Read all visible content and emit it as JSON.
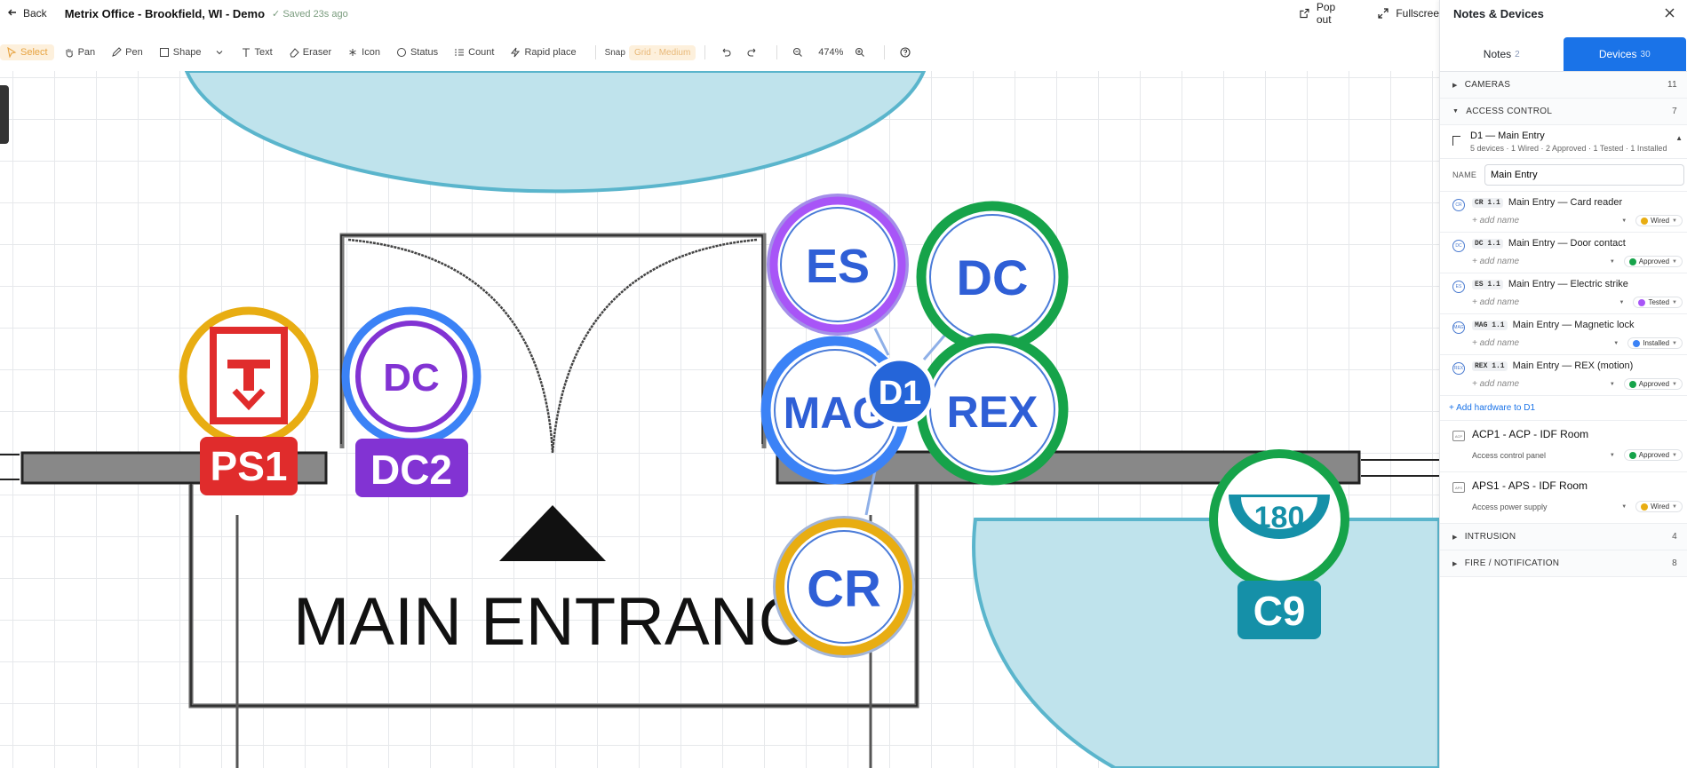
{
  "header": {
    "back_label": "Back",
    "title": "Metrix Office - Brookfield, WI - Demo",
    "saved": "✓ Saved 23s ago",
    "popout": "Pop out",
    "fullscreen": "Fullscree"
  },
  "toolbar": {
    "tools": [
      "Select",
      "Pan",
      "Pen",
      "Shape",
      "Text",
      "Eraser",
      "Icon",
      "Status",
      "Count",
      "Rapid place"
    ],
    "snap": "Snap",
    "grid": "Grid · Medium",
    "zoom": "474%"
  },
  "canvas": {
    "entrance_label": "MAIN ENTRANC",
    "devices": {
      "ps1": "PS1",
      "dc2_icon": "DC",
      "dc2": "DC2",
      "es": "ES",
      "dc": "DC",
      "mag": "MAG",
      "d1": "D1",
      "rex": "REX",
      "cr": "CR",
      "c9_angle": "180",
      "c9": "C9"
    },
    "colors": {
      "red": "#e02c2c",
      "purple": "#8233d3",
      "blue": "#3b82f6",
      "green": "#16a34a",
      "yellow": "#e8ad12",
      "teal": "#1590a8",
      "text_blue": "#2f5fd6",
      "room": "#bfe3ec"
    }
  },
  "panel": {
    "title": "Notes & Devices",
    "tabs": [
      {
        "label": "Notes",
        "count": "2"
      },
      {
        "label": "Devices",
        "count": "30"
      }
    ],
    "categories": {
      "cameras": {
        "label": "CAMERAS",
        "count": "11"
      },
      "access": {
        "label": "ACCESS CONTROL",
        "count": "7"
      },
      "intrusion": {
        "label": "INTRUSION",
        "count": "4"
      },
      "fire": {
        "label": "FIRE / NOTIFICATION",
        "count": "8"
      }
    },
    "door": {
      "title": "D1 — Main Entry",
      "summary": "5 devices · 1 Wired · 2 Approved · 1 Tested · 1 Installed",
      "name_label": "NAME",
      "name_value": "Main Entry"
    },
    "devices": [
      {
        "icon": "CR",
        "code": "CR 1.1",
        "label": "Main Entry — Card reader",
        "placeholder": "+ add name",
        "status": "Wired",
        "color": "#e8ad12"
      },
      {
        "icon": "DC",
        "code": "DC 1.1",
        "label": "Main Entry — Door contact",
        "placeholder": "+ add name",
        "status": "Approved",
        "color": "#16a34a"
      },
      {
        "icon": "ES",
        "code": "ES 1.1",
        "label": "Main Entry — Electric strike",
        "placeholder": "+ add name",
        "status": "Tested",
        "color": "#a855f7"
      },
      {
        "icon": "MAG",
        "code": "MAG 1.1",
        "label": "Main Entry — Magnetic lock",
        "placeholder": "+ add name",
        "status": "Installed",
        "color": "#3b82f6"
      },
      {
        "icon": "REX",
        "code": "REX 1.1",
        "label": "Main Entry — REX (motion)",
        "placeholder": "+ add name",
        "status": "Approved",
        "color": "#16a34a"
      }
    ],
    "add_hardware": "+ Add hardware to D1",
    "panels": [
      {
        "icon": "ACP",
        "title": "ACP1 - ACP - IDF Room",
        "desc": "Access control panel",
        "status": "Approved",
        "color": "#16a34a"
      },
      {
        "icon": "APS",
        "title": "APS1 - APS - IDF Room",
        "desc": "Access power supply",
        "status": "Wired",
        "color": "#e8ad12"
      }
    ]
  }
}
